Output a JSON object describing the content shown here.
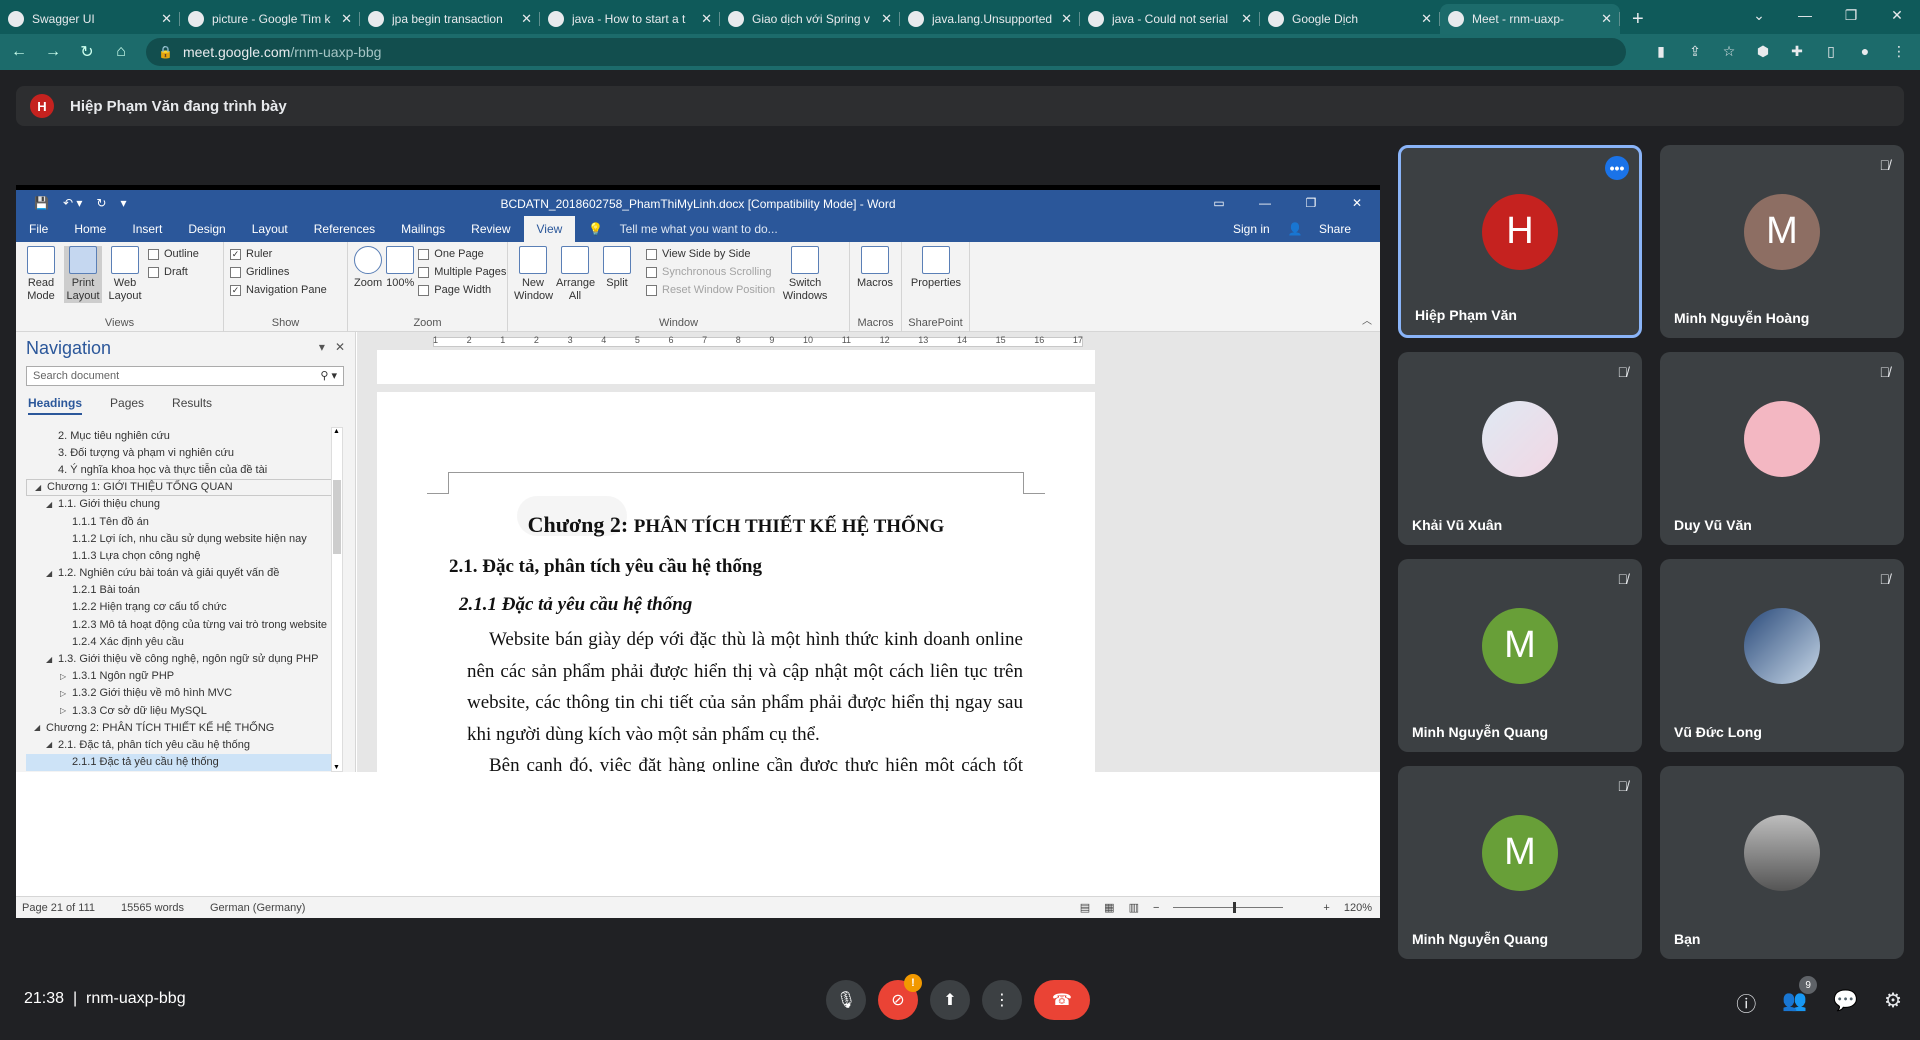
{
  "browser": {
    "tabs": [
      {
        "title": "Swagger UI",
        "icon": "swagger-icon"
      },
      {
        "title": "picture - Google Tìm k",
        "icon": "google-icon"
      },
      {
        "title": "jpa begin transaction",
        "icon": "google-icon"
      },
      {
        "title": "java - How to start a t",
        "icon": "stackoverflow-icon"
      },
      {
        "title": "Giao dịch với Spring v",
        "icon": "bookmark-icon"
      },
      {
        "title": "java.lang.Unsupported",
        "icon": "google-icon"
      },
      {
        "title": "java - Could not serial",
        "icon": "stackoverflow-icon"
      },
      {
        "title": "Google Dịch",
        "icon": "translate-icon"
      },
      {
        "title": "Meet - rnm-uaxp-",
        "icon": "meet-icon"
      }
    ],
    "url_host": "meet.google.com",
    "url_path": "/rnm-uaxp-bbg"
  },
  "meet": {
    "presenter_initial": "H",
    "presenter_banner": "Hiệp Phạm Văn đang trình bày",
    "participants": [
      {
        "name": "Hiệp Phạm Văn",
        "initial": "H",
        "color": "#c5221f"
      },
      {
        "name": "Minh Nguyễn Hoàng",
        "initial": "M",
        "color": "#8d6e63"
      },
      {
        "name": "Khải Vũ Xuân"
      },
      {
        "name": "Duy Vũ Văn"
      },
      {
        "name": "Minh Nguyễn Quang",
        "initial": "M",
        "color": "#689f38"
      },
      {
        "name": "Vũ Đức Long"
      },
      {
        "name": "Minh Nguyễn Quang",
        "initial": "M",
        "color": "#689f38"
      },
      {
        "name": "Bạn"
      }
    ],
    "time": "21:38",
    "meeting_code": "rnm-uaxp-bbg",
    "notification_badge": "!",
    "people_count": "9"
  },
  "word": {
    "title": "BCDATN_2018602758_PhamThiMyLinh.docx [Compatibility Mode] - Word",
    "menu": [
      "File",
      "Home",
      "Insert",
      "Design",
      "Layout",
      "References",
      "Mailings",
      "Review",
      "View"
    ],
    "tell_me": "Tell me what you want to do...",
    "sign_in": "Sign in",
    "share": "Share",
    "ribbon": {
      "views": {
        "label": "Views",
        "read": "Read Mode",
        "print": "Print Layout",
        "web": "Web Layout",
        "outline": "Outline",
        "draft": "Draft"
      },
      "show": {
        "label": "Show",
        "ruler": "Ruler",
        "gridlines": "Gridlines",
        "nav_pane": "Navigation Pane"
      },
      "zoom": {
        "label": "Zoom",
        "zoom": "Zoom",
        "pct": "100%",
        "one_page": "One Page",
        "multi": "Multiple Pages",
        "width": "Page Width"
      },
      "window": {
        "label": "Window",
        "new": "New Window",
        "arrange": "Arrange All",
        "split": "Split",
        "side": "View Side by Side",
        "sync": "Synchronous Scrolling",
        "reset": "Reset Window Position",
        "switch": "Switch Windows"
      },
      "macros": {
        "label": "Macros",
        "macros": "Macros"
      },
      "sharepoint": {
        "label": "SharePoint",
        "props": "Properties"
      }
    },
    "nav": {
      "title": "Navigation",
      "search_placeholder": "Search document",
      "tabs": [
        "Headings",
        "Pages",
        "Results"
      ],
      "headings": [
        {
          "text": "2. Mục tiêu nghiên cứu",
          "level": 2
        },
        {
          "text": "3. Đối tượng và phạm vi nghiên cứu",
          "level": 2
        },
        {
          "text": "4. Ý nghĩa khoa học và thực tiễn của đề tài",
          "level": 2
        },
        {
          "text": "Chương 1: GIỚI THIỆU TỔNG QUAN",
          "level": 1,
          "tri": "◢",
          "hover": true
        },
        {
          "text": "1.1. Giới thiệu chung",
          "level": 2,
          "tri": "◢"
        },
        {
          "text": "1.1.1  Tên đồ án",
          "level": 3
        },
        {
          "text": "1.1.2  Lợi ích, nhu cầu sử dụng website hiện nay",
          "level": 3
        },
        {
          "text": "1.1.3  Lựa chọn công nghệ",
          "level": 3
        },
        {
          "text": "1.2. Nghiên cứu bài toán và giải quyết vấn đề",
          "level": 2,
          "tri": "◢"
        },
        {
          "text": "1.2.1  Bài toán",
          "level": 3
        },
        {
          "text": "1.2.2  Hiện trạng cơ cấu tổ chức",
          "level": 3
        },
        {
          "text": "1.2.3  Mô tả hoạt động của từng vai trò trong website",
          "level": 3
        },
        {
          "text": "1.2.4  Xác định yêu cầu",
          "level": 3
        },
        {
          "text": "1.3. Giới thiệu về công nghệ, ngôn ngữ sử dụng PHP",
          "level": 2,
          "tri": "◢"
        },
        {
          "text": "1.3.1  Ngôn ngữ PHP",
          "level": 3,
          "tri": "▷"
        },
        {
          "text": "1.3.2  Giới thiệu về mô hình MVC",
          "level": 3,
          "tri": "▷"
        },
        {
          "text": "1.3.3  Cơ sở dữ liệu MySQL",
          "level": 3,
          "tri": "▷"
        },
        {
          "text": "Chương 2: PHÂN TÍCH THIẾT KẾ HỆ THỐNG",
          "level": 1,
          "tri": "◢"
        },
        {
          "text": "2.1. Đặc tả, phân tích yêu cầu hệ thống",
          "level": 2,
          "tri": "◢"
        },
        {
          "text": "2.1.1 Đặc tả yêu cầu hệ thống",
          "level": 3,
          "selected": true
        }
      ]
    },
    "ruler_nums": [
      "1",
      "2",
      "1",
      "2",
      "3",
      "4",
      "5",
      "6",
      "7",
      "8",
      "9",
      "10",
      "11",
      "12",
      "13",
      "14",
      "15",
      "16",
      "17"
    ],
    "doc": {
      "chapter_prefix": "Chương 2: ",
      "chapter_title": "PHÂN TÍCH THIẾT KẾ HỆ THỐNG",
      "section": "2.1. Đặc tả, phân tích yêu cầu hệ thống",
      "subsection": "2.1.1 Đặc tả yêu cầu hệ thống",
      "para1": "Website bán giày dép với đặc thù là một hình thức kinh doanh online nên các sản phẩm phải được hiển thị và cập nhật một cách liên tục trên website, các thông tin chi tiết của sản phẩm phải được hiển thị ngay sau khi người dùng kích vào một sản phẩm cụ thể.",
      "para2": "Bên cạnh đó, việc đặt hàng online cần được thực hiện một cách tốt nhất"
    },
    "status": {
      "page": "Page 21 of 111",
      "words": "15565 words",
      "lang": "German (Germany)",
      "zoom": "120%"
    }
  }
}
